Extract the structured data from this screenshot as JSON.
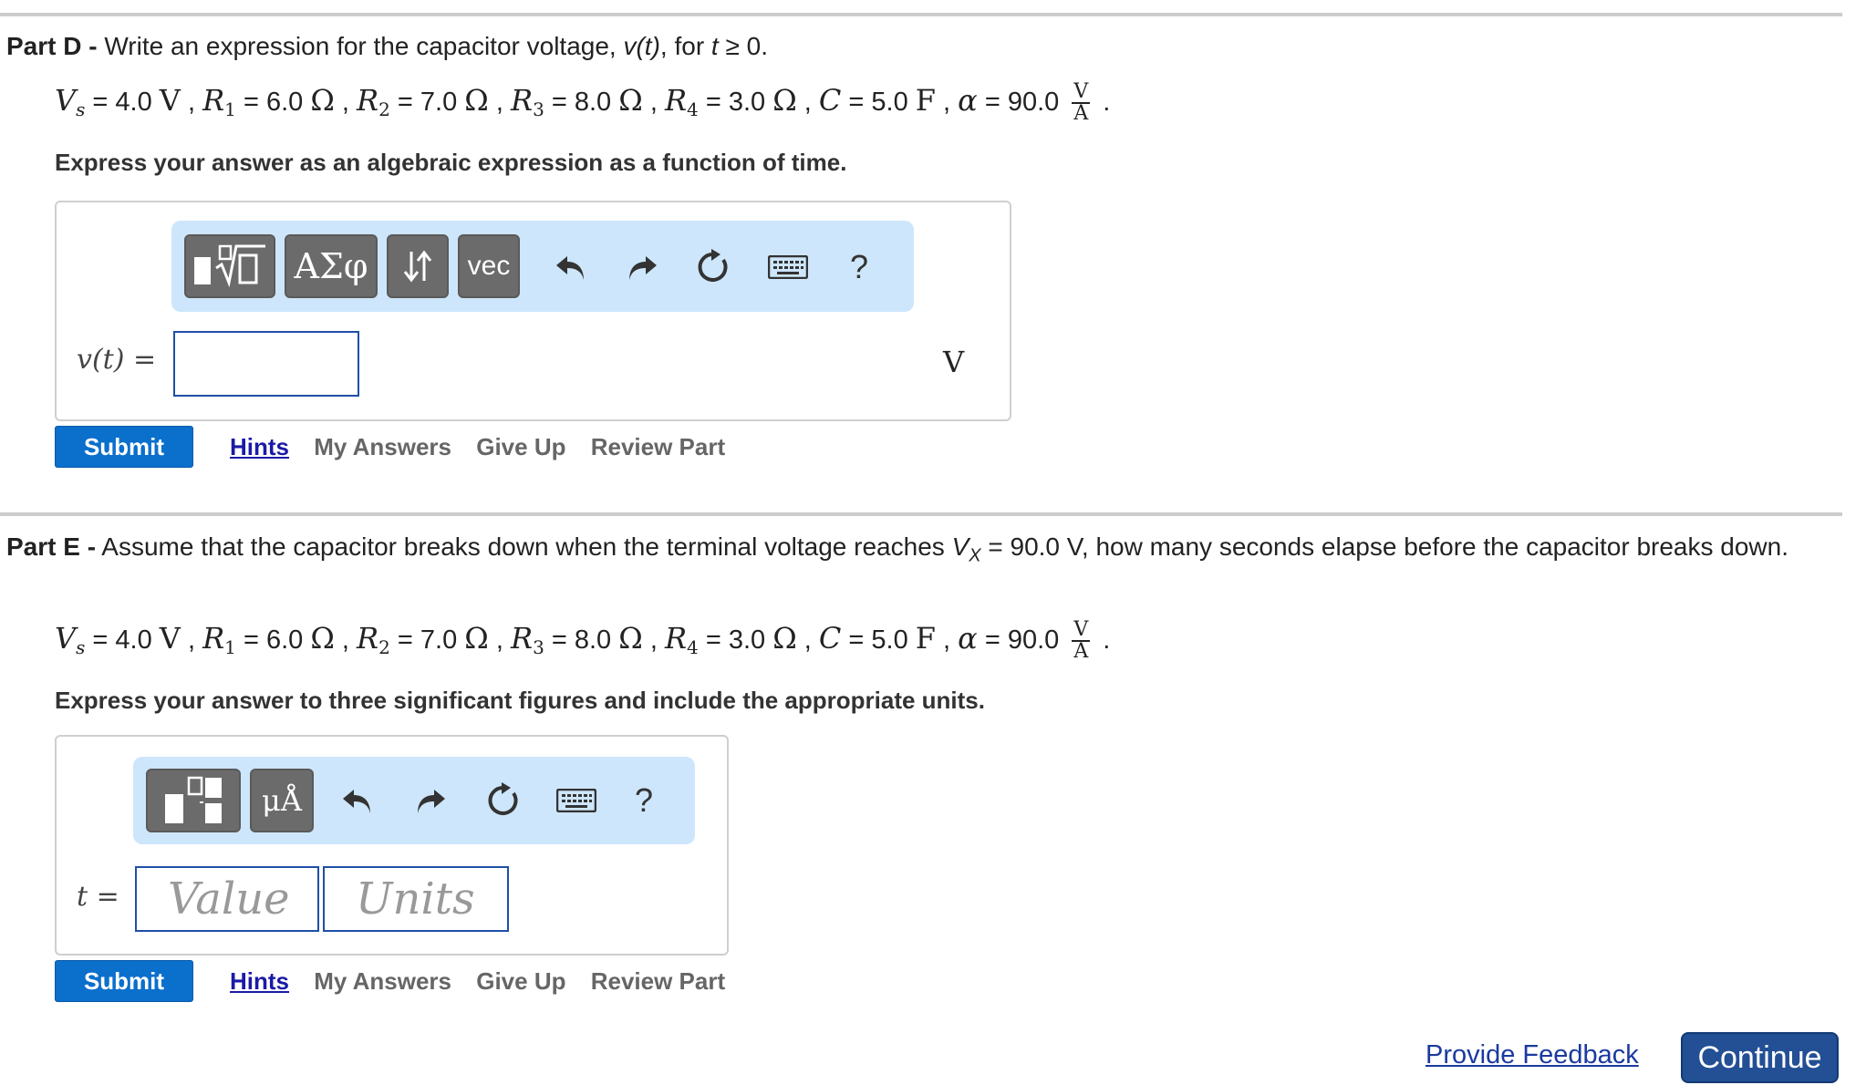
{
  "part_d": {
    "label": "Part D -",
    "prompt": "Write an expression for the capacitor voltage,",
    "prompt_var": "v(t)",
    "prompt_mid": ", for",
    "prompt_cond_var": "t",
    "prompt_cond": "≥ 0.",
    "givens": {
      "vs_sym": "V",
      "vs_sub": "s",
      "vs_val": " = 4.0 ",
      "vs_unit": "V",
      "r1_sym": "R",
      "r1_sub": "1",
      "r1_val": " = 6.0 ",
      "r1_unit": "Ω",
      "r2_sym": "R",
      "r2_sub": "2",
      "r2_val": " = 7.0 ",
      "r2_unit": "Ω",
      "r3_sym": "R",
      "r3_sub": "3",
      "r3_val": " = 8.0 ",
      "r3_unit": "Ω",
      "r4_sym": "R",
      "r4_sub": "4",
      "r4_val": " = 3.0 ",
      "r4_unit": "Ω",
      "c_sym": "C",
      "c_val": " = 5.0 ",
      "c_unit": "F",
      "alpha_sym": "α",
      "alpha_val": " = 90.0 ",
      "alpha_num": "V",
      "alpha_den": "A",
      "sep": " , ",
      "end": " ."
    },
    "instruction": "Express your answer as an algebraic expression as a function of time.",
    "toolbar": {
      "templates_label": "▮√▯",
      "greek_label": "ΑΣφ",
      "arrows_label": "↓↑",
      "vec_label": "vec",
      "help_label": "?"
    },
    "variable_label": "v(t) =",
    "unit": "V",
    "submit_label": "Submit",
    "links": {
      "hints": "Hints",
      "my_answers": "My Answers",
      "give_up": "Give Up",
      "review": "Review Part"
    }
  },
  "part_e": {
    "label": "Part E -",
    "prompt_a": "Assume that the capacitor breaks down when the terminal voltage reaches",
    "prompt_var": "V",
    "prompt_sub": "X",
    "prompt_b": "= 90.0 V, how many seconds elapse before the capacitor breaks down.",
    "givens": {
      "vs_sym": "V",
      "vs_sub": "s",
      "vs_val": " = 4.0 ",
      "vs_unit": "V",
      "r1_sym": "R",
      "r1_sub": "1",
      "r1_val": " = 6.0 ",
      "r1_unit": "Ω",
      "r2_sym": "R",
      "r2_sub": "2",
      "r2_val": " = 7.0 ",
      "r2_unit": "Ω",
      "r3_sym": "R",
      "r3_sub": "3",
      "r3_val": " = 8.0 ",
      "r3_unit": "Ω",
      "r4_sym": "R",
      "r4_sub": "4",
      "r4_val": " = 3.0 ",
      "r4_unit": "Ω",
      "c_sym": "C",
      "c_val": " = 5.0 ",
      "c_unit": "F",
      "alpha_sym": "α",
      "alpha_val": " = 90.0 ",
      "alpha_num": "V",
      "alpha_den": "A",
      "sep": " , ",
      "end": " ."
    },
    "instruction": "Express your answer to three significant figures and include the appropriate units.",
    "toolbar": {
      "units_label": "μÅ",
      "help_label": "?"
    },
    "variable_label": "t =",
    "value_placeholder": "Value",
    "units_placeholder": "Units",
    "submit_label": "Submit",
    "links": {
      "hints": "Hints",
      "my_answers": "My Answers",
      "give_up": "Give Up",
      "review": "Review Part"
    }
  },
  "footer": {
    "feedback_label": "Provide Feedback",
    "continue_label": "Continue"
  },
  "colors": {
    "submit": "#0b6fcc",
    "continue": "#234f95",
    "toolbar_bg": "#cde6fb",
    "link": "#1a1aa6"
  }
}
